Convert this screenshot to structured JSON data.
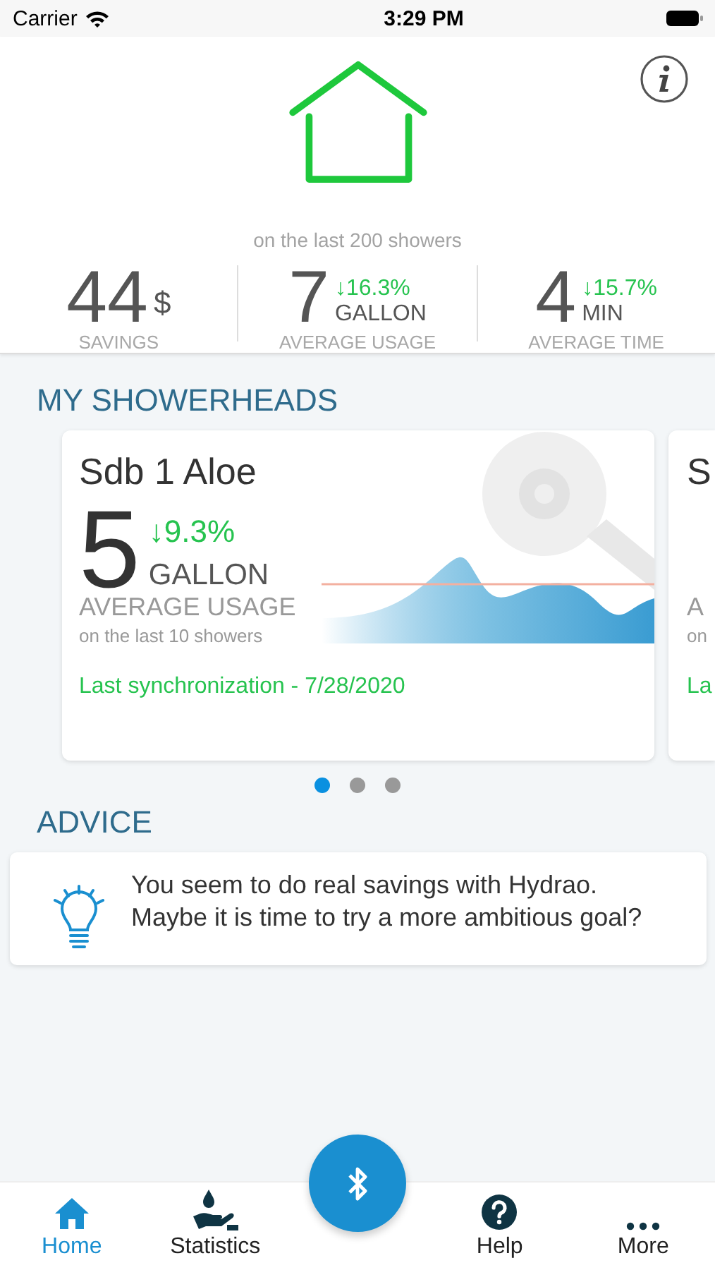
{
  "status_bar": {
    "carrier": "Carrier",
    "time": "3:29 PM"
  },
  "summary": {
    "caption": "on the last 200 showers",
    "stats": [
      {
        "value": "44",
        "unit": "$",
        "label": "SAVINGS"
      },
      {
        "value": "7",
        "change": "↓16.3%",
        "unit": "GALLON",
        "label": "AVERAGE USAGE"
      },
      {
        "value": "4",
        "change": "↓15.7%",
        "unit": "MIN",
        "label": "AVERAGE TIME"
      }
    ]
  },
  "showerheads": {
    "title": "MY SHOWERHEADS",
    "cards": [
      {
        "name": "Sdb 1 Aloe",
        "value": "5",
        "change": "↓9.3%",
        "unit": "GALLON",
        "label": "AVERAGE USAGE",
        "caption": "on the last 10 showers",
        "sync": "Last synchronization - 7/28/2020"
      },
      {
        "name": "S",
        "label": "A",
        "caption": "on",
        "sync": "La"
      }
    ],
    "pages": [
      {
        "selected": true
      },
      {
        "selected": false
      },
      {
        "selected": false
      }
    ]
  },
  "advice": {
    "title": "ADVICE",
    "text": "You seem to do real savings with Hydrao. Maybe it is time to try a more ambitious goal?"
  },
  "tabs": [
    {
      "kind": "home",
      "label": "Home",
      "selected": true
    },
    {
      "kind": "statistics",
      "label": "Statistics",
      "selected": false
    },
    {
      "kind": "help",
      "label": "Help",
      "selected": false
    },
    {
      "kind": "more",
      "label": "More",
      "selected": false
    }
  ]
}
